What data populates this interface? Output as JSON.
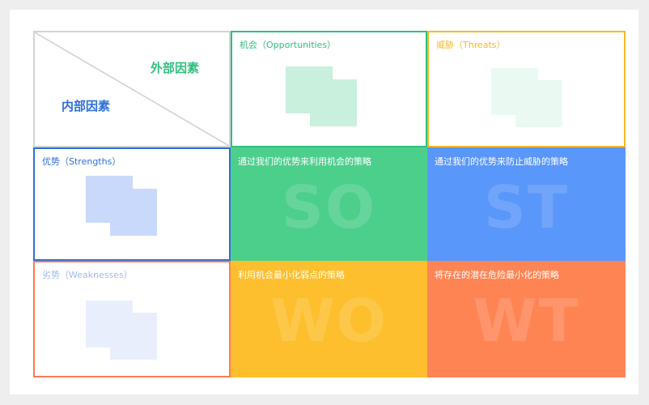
{
  "diagram": {
    "corner": {
      "external_label": "外部因素",
      "internal_label": "内部因素"
    },
    "columns": [
      {
        "label": "机会（Opportunities）",
        "color": "#2fbf7f"
      },
      {
        "label": "威胁（Threats）",
        "color": "#f5b928"
      }
    ],
    "rows": [
      {
        "label": "优势（Strengths）",
        "color": "#2e6fd8"
      },
      {
        "label": "劣势（Weaknesses）",
        "color": "#ff7b52"
      }
    ],
    "quadrants": {
      "so": {
        "text": "通过我们的优势来利用机会的策略",
        "watermark": "SO",
        "color": "#4dcf8c"
      },
      "st": {
        "text": "通过我们的优势来防止威胁的策略",
        "watermark": "ST",
        "color": "#5a97fa"
      },
      "wo": {
        "text": "利用机会最小化弱点的策略",
        "watermark": "WO",
        "color": "#fdbf2d"
      },
      "wt": {
        "text": "将存在的潜在危险最小化的策略",
        "watermark": "WT",
        "color": "#ff8454"
      }
    }
  }
}
